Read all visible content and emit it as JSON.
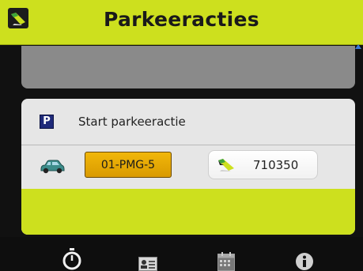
{
  "header": {
    "title": "Parkeeracties",
    "logo_icon": "parking-app-logo-icon"
  },
  "action": {
    "label": "Start parkeeractie",
    "icon_letter": "P"
  },
  "vehicle": {
    "plate": "01-PMG-5",
    "icon": "car-icon"
  },
  "zone": {
    "code": "710350",
    "icon": "parking-zone-icon"
  },
  "tabs": [
    {
      "icon": "stopwatch-icon"
    },
    {
      "icon": "id-card-icon"
    },
    {
      "icon": "calendar-icon"
    },
    {
      "icon": "info-icon"
    }
  ],
  "colors": {
    "accent": "#cde01e",
    "plate": "#e6a800",
    "panel": "#8a8a8a",
    "card": "#e6e6e6"
  }
}
